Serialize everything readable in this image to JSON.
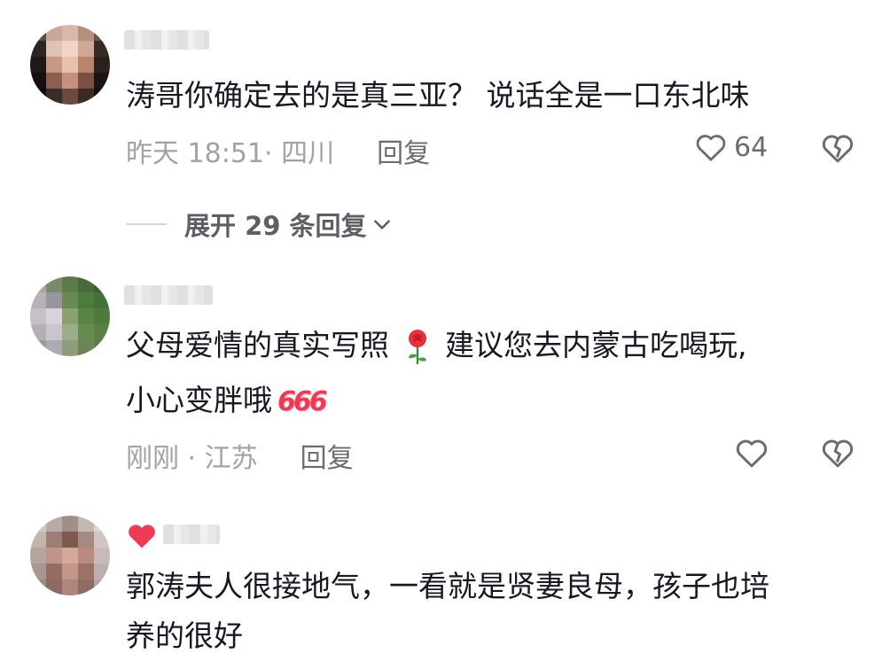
{
  "comments": [
    {
      "text": "涛哥你确定去的是真三亚？  说话全是一口东北味",
      "meta": "昨天 18:51· 四川",
      "reply_label": "回复",
      "like_count": "64",
      "expand_label": "展开 29 条回复"
    },
    {
      "text_line1_a": "父母爱情的真实写照",
      "text_line1_b": "建议您去内蒙古吃喝玩,",
      "text_line2": "小心变胖哦",
      "badge": "666",
      "meta": "刚刚 · 江苏",
      "reply_label": "回复",
      "like_count": ""
    },
    {
      "text_line1": "郭涛夫人很接地气，一看就是贤妻良母，孩子也培",
      "text_line2": "养的很好"
    }
  ],
  "colors": {
    "accent_red": "#f03a55",
    "meta_gray": "#a1a2a8",
    "text": "#161823"
  },
  "icons": [
    "heart-outline-icon",
    "broken-heart-icon",
    "chevron-down-icon",
    "rose-emoji-icon",
    "red-heart-icon"
  ]
}
